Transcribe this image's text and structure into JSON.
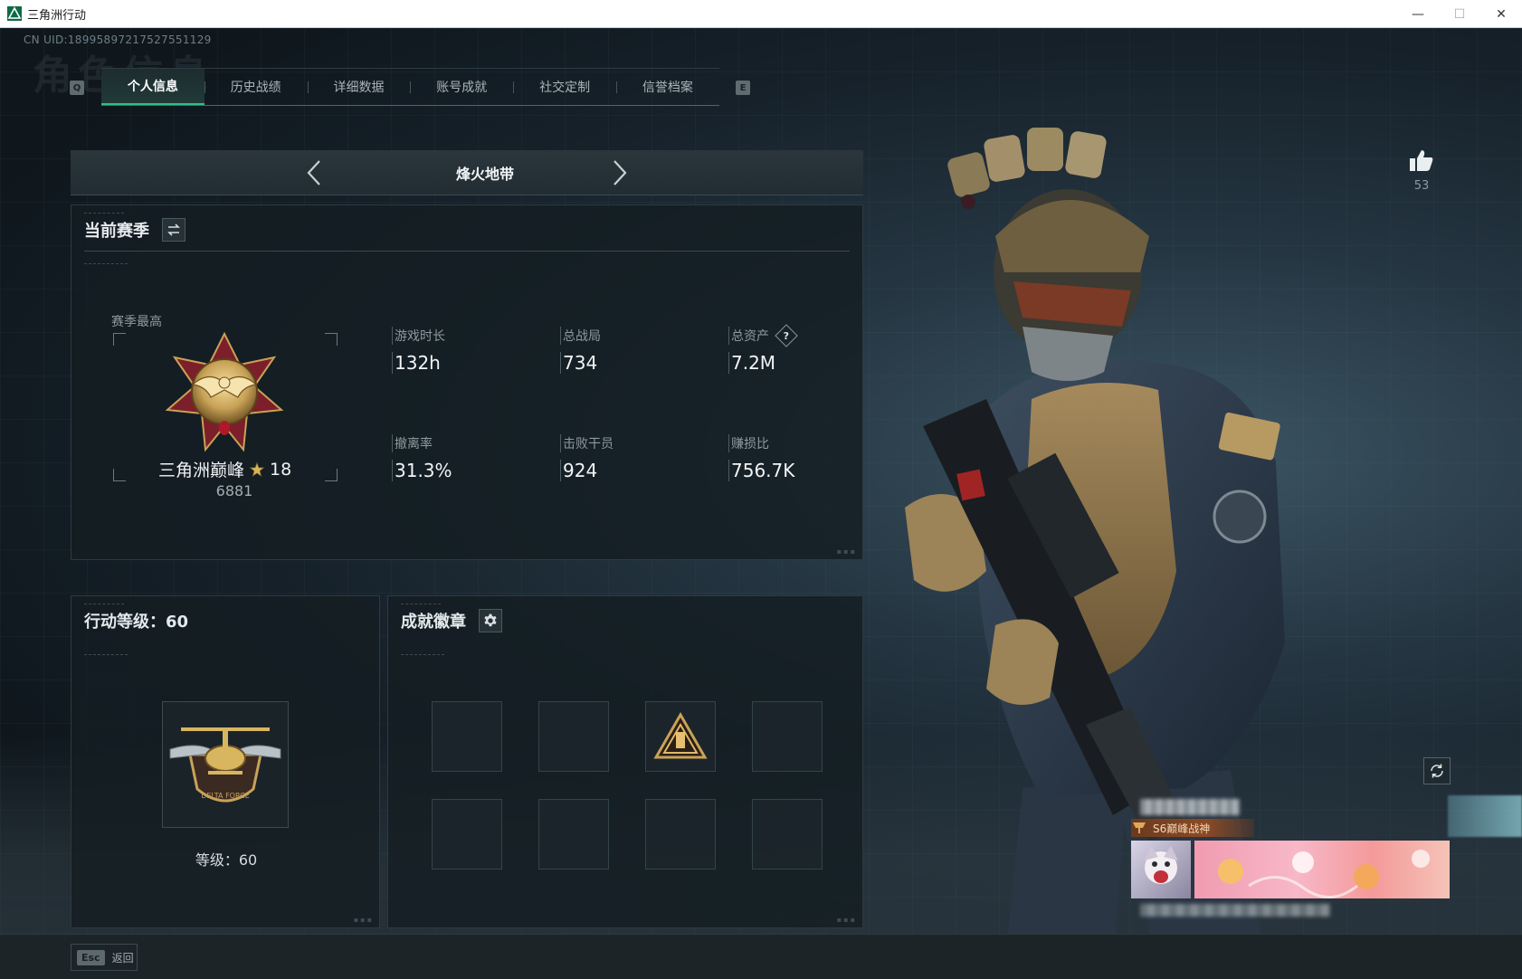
{
  "window": {
    "title": "三角洲行动",
    "minimize": "—",
    "maximize": "☐",
    "close": "✕"
  },
  "uid": "CN UID:18995897217527551129",
  "background_text": "角色信息",
  "tabs": [
    {
      "label": "个人信息",
      "active": true
    },
    {
      "label": "历史战绩",
      "active": false
    },
    {
      "label": "详细数据",
      "active": false
    },
    {
      "label": "账号成就",
      "active": false
    },
    {
      "label": "社交定制",
      "active": false
    },
    {
      "label": "信誉档案",
      "active": false
    }
  ],
  "tab_keys": {
    "prev": "Q",
    "next": "E"
  },
  "mode": {
    "title": "烽火地带",
    "prev_icon": "chevron-left-icon",
    "next_icon": "chevron-right-icon"
  },
  "season": {
    "header": "当前赛季",
    "switch_icon": "swap-icon",
    "best_label": "赛季最高",
    "rank_name": "三角洲巅峰",
    "rank_stars": "18",
    "rank_score": "6881",
    "stats": [
      {
        "label": "游戏时长",
        "value": "132h"
      },
      {
        "label": "总战局",
        "value": "734"
      },
      {
        "label": "总资产",
        "value": "7.2M",
        "help": "?"
      },
      {
        "label": "撤离率",
        "value": "31.3%"
      },
      {
        "label": "击败干员",
        "value": "924"
      },
      {
        "label": "赚损比",
        "value": "756.7K"
      }
    ]
  },
  "level_panel": {
    "header": "行动等级：60",
    "level_label": "等级：60"
  },
  "badge_panel": {
    "header": "成就徽章",
    "settings_icon": "gear-icon",
    "slot_count": 8,
    "filled_slot": 2
  },
  "likes": {
    "count": "53",
    "icon": "thumbs-up-icon"
  },
  "card": {
    "title": "S6巅峰战神"
  },
  "bottom": {
    "esc_key": "Esc",
    "esc_label": "返回"
  },
  "colors": {
    "accent_green": "#2fbf8a",
    "gold": "#c8a257",
    "panel_bg": "#141d22"
  }
}
